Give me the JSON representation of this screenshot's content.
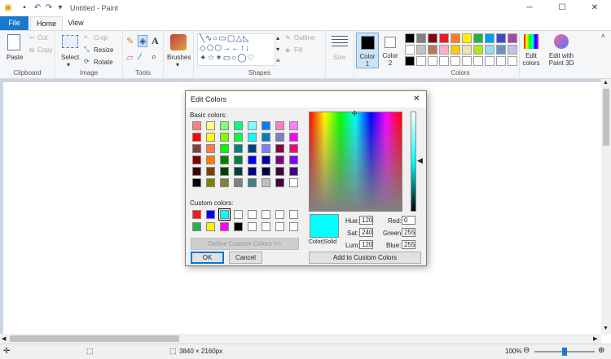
{
  "window": {
    "title": "Untitled - Paint",
    "minimize": "─",
    "maximize": "☐",
    "close": "✕"
  },
  "tabs": {
    "file": "File",
    "home": "Home",
    "view": "View"
  },
  "ribbon": {
    "clipboard": {
      "label": "Clipboard",
      "paste": "Paste",
      "cut": "Cut",
      "copy": "Copy"
    },
    "image": {
      "label": "Image",
      "select": "Select",
      "crop": "Crop",
      "resize": "Resize",
      "rotate": "Rotate"
    },
    "tools": {
      "label": "Tools"
    },
    "brushes": {
      "label": "Brushes"
    },
    "shapes": {
      "label": "Shapes",
      "outline": "Outline",
      "fill": "Fill"
    },
    "size": {
      "label": "Size"
    },
    "color1": {
      "label": "Color 1"
    },
    "color2": {
      "label": "Color 2"
    },
    "colors": {
      "label": "Colors",
      "edit": "Edit colors",
      "paint3d": "Edit with Paint 3D",
      "palette": [
        "#000000",
        "#7f7f7f",
        "#880015",
        "#ed1c24",
        "#ff7f27",
        "#fff200",
        "#22b14c",
        "#00a2e8",
        "#3f48cc",
        "#a349a4",
        "#ffffff",
        "#c3c3c3",
        "#b97a57",
        "#ffaec9",
        "#ffc90e",
        "#efe4b0",
        "#b5e61d",
        "#99d9ea",
        "#7092be",
        "#c8bfe7",
        "#000000",
        "#ffffff",
        "#ffffff",
        "#ffffff",
        "#ffffff",
        "#ffffff",
        "#ffffff",
        "#ffffff",
        "#ffffff",
        "#ffffff"
      ]
    }
  },
  "status": {
    "dimensions": "3840 × 2160px",
    "zoom": "100%",
    "zoom_level": 0.5
  },
  "dialog": {
    "title": "Edit Colors",
    "close": "✕",
    "basic_label": "Basic colors:",
    "custom_label": "Custom colors:",
    "basic_colors": [
      "#ff8080",
      "#ffff80",
      "#80ff80",
      "#00ff80",
      "#80ffff",
      "#0080ff",
      "#ff80c0",
      "#ff80ff",
      "#ff0000",
      "#ffff00",
      "#80ff00",
      "#00ff40",
      "#00ffff",
      "#0080c0",
      "#8080c0",
      "#ff00ff",
      "#804040",
      "#ff8040",
      "#00ff00",
      "#008080",
      "#004080",
      "#8080ff",
      "#800040",
      "#ff0080",
      "#800000",
      "#ff8000",
      "#008000",
      "#008040",
      "#0000ff",
      "#0000a0",
      "#800080",
      "#8000ff",
      "#400000",
      "#804000",
      "#004000",
      "#004040",
      "#000080",
      "#000040",
      "#400040",
      "#400080",
      "#000000",
      "#808000",
      "#808040",
      "#808080",
      "#408080",
      "#c0c0c0",
      "#400040",
      "#ffffff"
    ],
    "custom_colors": [
      "#ed1c24",
      "#0000ff",
      "#00ffff",
      "#ffffff",
      "#ffffff",
      "#ffffff",
      "#ffffff",
      "#ffffff",
      "#22b14c",
      "#fff200",
      "#ff00ff",
      "#000000",
      "#ffffff",
      "#ffffff",
      "#ffffff",
      "#ffffff"
    ],
    "define": "Define Custom Colors >>",
    "ok": "OK",
    "cancel": "Cancel",
    "preview_label": "Color|Solid",
    "preview_color": "#00ffff",
    "hue_label": "Hue:",
    "hue": "120",
    "sat_label": "Sat:",
    "sat": "240",
    "lum_label": "Lum:",
    "lum": "120",
    "red_label": "Red:",
    "red": "0",
    "green_label": "Green:",
    "green": "255",
    "blue_label": "Blue:",
    "blue": "255",
    "add": "Add to Custom Colors"
  }
}
